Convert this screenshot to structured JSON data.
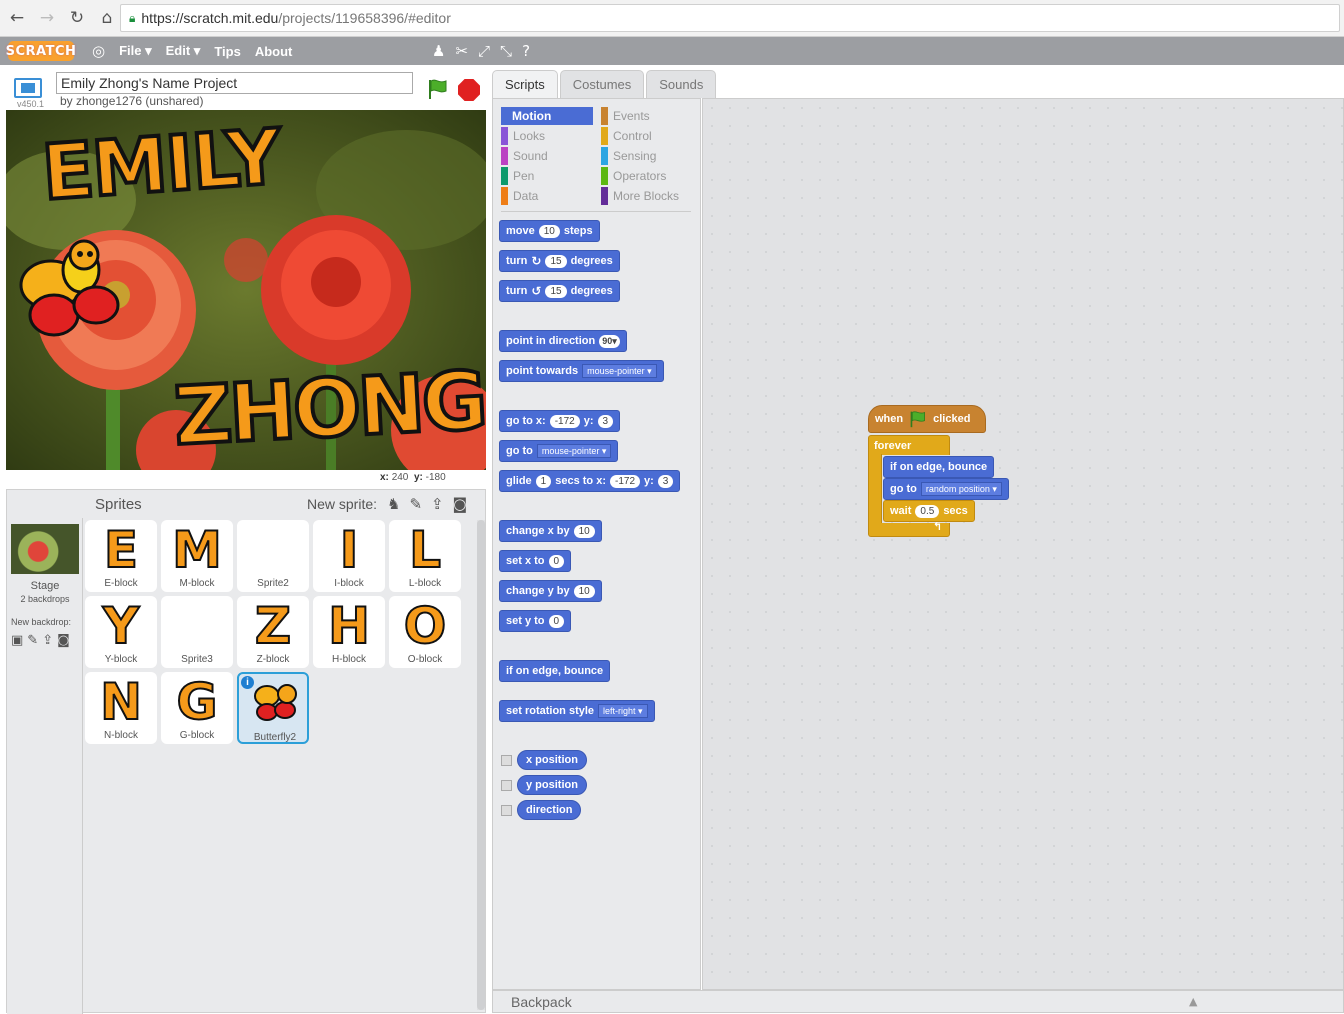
{
  "browser": {
    "url_main": "https://scratch.mit.edu",
    "url_rest": "/projects/119658396/#editor"
  },
  "menubar": {
    "logo": "SCRATCH",
    "items": [
      "File ▾",
      "Edit ▾",
      "Tips",
      "About"
    ]
  },
  "project": {
    "version": "v450.1",
    "title": "Emily Zhong's Name Project",
    "author": "by zhonge1276 (unshared)"
  },
  "stage": {
    "word1": "EMILY",
    "word2": "ZHONG",
    "coords_x_label": "x:",
    "coords_x": "240",
    "coords_y_label": "y:",
    "coords_y": "-180"
  },
  "sprites": {
    "label": "Sprites",
    "new_sprite_label": "New sprite:",
    "stage_label": "Stage",
    "backdrops": "2 backdrops",
    "new_backdrop": "New backdrop:",
    "tiles": [
      {
        "glyph": "E",
        "name": "E-block"
      },
      {
        "glyph": "M",
        "name": "M-block"
      },
      {
        "glyph": "",
        "name": "Sprite2"
      },
      {
        "glyph": "I",
        "name": "I-block"
      },
      {
        "glyph": "L",
        "name": "L-block"
      },
      {
        "glyph": "Y",
        "name": "Y-block"
      },
      {
        "glyph": "",
        "name": "Sprite3"
      },
      {
        "glyph": "Z",
        "name": "Z-block"
      },
      {
        "glyph": "H",
        "name": "H-block"
      },
      {
        "glyph": "O",
        "name": "O-block"
      },
      {
        "glyph": "N",
        "name": "N-block"
      },
      {
        "glyph": "G",
        "name": "G-block"
      },
      {
        "glyph": "",
        "name": "Butterfly2"
      }
    ]
  },
  "tabs": [
    "Scripts",
    "Costumes",
    "Sounds"
  ],
  "categories": {
    "left": [
      "Motion",
      "Looks",
      "Sound",
      "Pen",
      "Data"
    ],
    "right": [
      "Events",
      "Control",
      "Sensing",
      "Operators",
      "More Blocks"
    ]
  },
  "blocks": {
    "move": {
      "a": "move",
      "n": "10",
      "b": "steps"
    },
    "turn_cw": {
      "a": "turn",
      "icon": "↻",
      "n": "15",
      "b": "degrees"
    },
    "turn_ccw": {
      "a": "turn",
      "icon": "↺",
      "n": "15",
      "b": "degrees"
    },
    "point_dir": {
      "a": "point in direction",
      "n": "90▾"
    },
    "point_towards": {
      "a": "point towards",
      "d": "mouse-pointer ▾"
    },
    "goto_xy": {
      "a": "go to x:",
      "x": "-172",
      "b": "y:",
      "y": "3"
    },
    "goto": {
      "a": "go to",
      "d": "mouse-pointer ▾"
    },
    "glide": {
      "a": "glide",
      "n": "1",
      "b": "secs to x:",
      "x": "-172",
      "c": "y:",
      "y": "3"
    },
    "change_x": {
      "a": "change x by",
      "n": "10"
    },
    "set_x": {
      "a": "set x to",
      "n": "0"
    },
    "change_y": {
      "a": "change y by",
      "n": "10"
    },
    "set_y": {
      "a": "set y to",
      "n": "0"
    },
    "bounce": {
      "a": "if on edge, bounce"
    },
    "rotation": {
      "a": "set rotation style",
      "d": "left-right ▾"
    },
    "rep_x": "x position",
    "rep_y": "y position",
    "rep_dir": "direction"
  },
  "script": {
    "when": "when",
    "clicked": "clicked",
    "forever": "forever",
    "bounce": "if on edge, bounce",
    "goto": "go to",
    "goto_target": "random position ▾",
    "wait": "wait",
    "wait_n": "0.5",
    "secs": "secs"
  },
  "backpack": "Backpack",
  "colors": {
    "motion": "#4a6cd4",
    "looks": "#8a55d7",
    "sound": "#bb42c3",
    "pen": "#0e9a6c",
    "data": "#ee7d16",
    "events": "#c88330",
    "control": "#e1a91a",
    "sensing": "#2ca5e2",
    "operators": "#5cb712",
    "more": "#632d99"
  }
}
